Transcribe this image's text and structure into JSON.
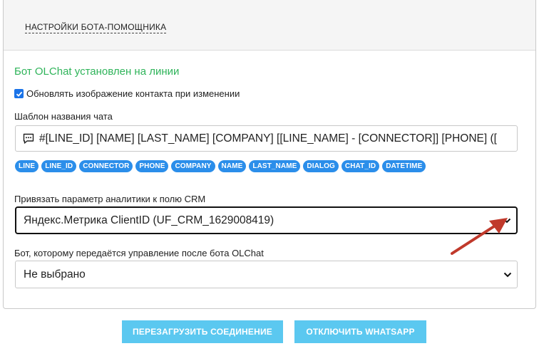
{
  "panel": {
    "title": "НАСТРОЙКИ БОТА-ПОМОЩНИКА",
    "status": "Бот OLChat установлен на линии",
    "checkbox_label": "Обновлять изображение контакта при изменении",
    "checkbox_checked": true,
    "template_label": "Шаблон названия чата",
    "template_value": "#[LINE_ID] [NAME] [LAST_NAME] [COMPANY] [[LINE_NAME] - [CONNECTOR]] [PHONE] ([",
    "tags": [
      "LINE",
      "LINE_ID",
      "CONNECTOR",
      "PHONE",
      "COMPANY",
      "NAME",
      "LAST_NAME",
      "DIALOG",
      "CHAT_ID",
      "DATETIME"
    ],
    "analytics_label": "Привязать параметр аналитики к полю CRM",
    "analytics_value": "Яндекс.Метрика ClientID (UF_CRM_1629008419)",
    "bot_label": "Бот, которому передаётся управление после бота OLChat",
    "bot_value": "Не выбрано"
  },
  "buttons": {
    "reload": "ПЕРЕЗАГРУЗИТЬ СОЕДИНЕНИЕ",
    "disconnect": "ОТКЛЮЧИТЬ WHATSAPP"
  },
  "colors": {
    "status_green": "#2fb45a",
    "tag_blue": "#2b8eea",
    "button_cyan": "#5bc8f0",
    "arrow_red": "#c0392b"
  }
}
